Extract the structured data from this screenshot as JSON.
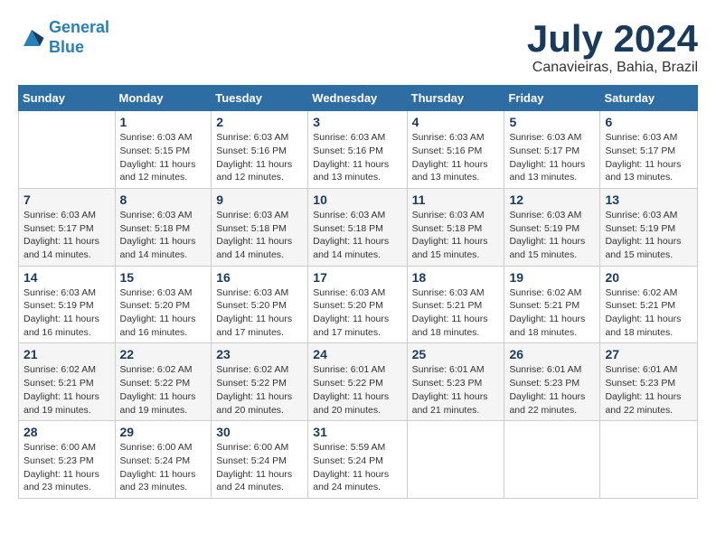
{
  "logo": {
    "line1": "General",
    "line2": "Blue"
  },
  "title": "July 2024",
  "location": "Canavieiras, Bahia, Brazil",
  "headers": [
    "Sunday",
    "Monday",
    "Tuesday",
    "Wednesday",
    "Thursday",
    "Friday",
    "Saturday"
  ],
  "weeks": [
    [
      {
        "day": "",
        "info": ""
      },
      {
        "day": "1",
        "info": "Sunrise: 6:03 AM\nSunset: 5:15 PM\nDaylight: 11 hours\nand 12 minutes."
      },
      {
        "day": "2",
        "info": "Sunrise: 6:03 AM\nSunset: 5:16 PM\nDaylight: 11 hours\nand 12 minutes."
      },
      {
        "day": "3",
        "info": "Sunrise: 6:03 AM\nSunset: 5:16 PM\nDaylight: 11 hours\nand 13 minutes."
      },
      {
        "day": "4",
        "info": "Sunrise: 6:03 AM\nSunset: 5:16 PM\nDaylight: 11 hours\nand 13 minutes."
      },
      {
        "day": "5",
        "info": "Sunrise: 6:03 AM\nSunset: 5:17 PM\nDaylight: 11 hours\nand 13 minutes."
      },
      {
        "day": "6",
        "info": "Sunrise: 6:03 AM\nSunset: 5:17 PM\nDaylight: 11 hours\nand 13 minutes."
      }
    ],
    [
      {
        "day": "7",
        "info": "Sunrise: 6:03 AM\nSunset: 5:17 PM\nDaylight: 11 hours\nand 14 minutes."
      },
      {
        "day": "8",
        "info": "Sunrise: 6:03 AM\nSunset: 5:18 PM\nDaylight: 11 hours\nand 14 minutes."
      },
      {
        "day": "9",
        "info": "Sunrise: 6:03 AM\nSunset: 5:18 PM\nDaylight: 11 hours\nand 14 minutes."
      },
      {
        "day": "10",
        "info": "Sunrise: 6:03 AM\nSunset: 5:18 PM\nDaylight: 11 hours\nand 14 minutes."
      },
      {
        "day": "11",
        "info": "Sunrise: 6:03 AM\nSunset: 5:18 PM\nDaylight: 11 hours\nand 15 minutes."
      },
      {
        "day": "12",
        "info": "Sunrise: 6:03 AM\nSunset: 5:19 PM\nDaylight: 11 hours\nand 15 minutes."
      },
      {
        "day": "13",
        "info": "Sunrise: 6:03 AM\nSunset: 5:19 PM\nDaylight: 11 hours\nand 15 minutes."
      }
    ],
    [
      {
        "day": "14",
        "info": "Sunrise: 6:03 AM\nSunset: 5:19 PM\nDaylight: 11 hours\nand 16 minutes."
      },
      {
        "day": "15",
        "info": "Sunrise: 6:03 AM\nSunset: 5:20 PM\nDaylight: 11 hours\nand 16 minutes."
      },
      {
        "day": "16",
        "info": "Sunrise: 6:03 AM\nSunset: 5:20 PM\nDaylight: 11 hours\nand 17 minutes."
      },
      {
        "day": "17",
        "info": "Sunrise: 6:03 AM\nSunset: 5:20 PM\nDaylight: 11 hours\nand 17 minutes."
      },
      {
        "day": "18",
        "info": "Sunrise: 6:03 AM\nSunset: 5:21 PM\nDaylight: 11 hours\nand 18 minutes."
      },
      {
        "day": "19",
        "info": "Sunrise: 6:02 AM\nSunset: 5:21 PM\nDaylight: 11 hours\nand 18 minutes."
      },
      {
        "day": "20",
        "info": "Sunrise: 6:02 AM\nSunset: 5:21 PM\nDaylight: 11 hours\nand 18 minutes."
      }
    ],
    [
      {
        "day": "21",
        "info": "Sunrise: 6:02 AM\nSunset: 5:21 PM\nDaylight: 11 hours\nand 19 minutes."
      },
      {
        "day": "22",
        "info": "Sunrise: 6:02 AM\nSunset: 5:22 PM\nDaylight: 11 hours\nand 19 minutes."
      },
      {
        "day": "23",
        "info": "Sunrise: 6:02 AM\nSunset: 5:22 PM\nDaylight: 11 hours\nand 20 minutes."
      },
      {
        "day": "24",
        "info": "Sunrise: 6:01 AM\nSunset: 5:22 PM\nDaylight: 11 hours\nand 20 minutes."
      },
      {
        "day": "25",
        "info": "Sunrise: 6:01 AM\nSunset: 5:23 PM\nDaylight: 11 hours\nand 21 minutes."
      },
      {
        "day": "26",
        "info": "Sunrise: 6:01 AM\nSunset: 5:23 PM\nDaylight: 11 hours\nand 22 minutes."
      },
      {
        "day": "27",
        "info": "Sunrise: 6:01 AM\nSunset: 5:23 PM\nDaylight: 11 hours\nand 22 minutes."
      }
    ],
    [
      {
        "day": "28",
        "info": "Sunrise: 6:00 AM\nSunset: 5:23 PM\nDaylight: 11 hours\nand 23 minutes."
      },
      {
        "day": "29",
        "info": "Sunrise: 6:00 AM\nSunset: 5:24 PM\nDaylight: 11 hours\nand 23 minutes."
      },
      {
        "day": "30",
        "info": "Sunrise: 6:00 AM\nSunset: 5:24 PM\nDaylight: 11 hours\nand 24 minutes."
      },
      {
        "day": "31",
        "info": "Sunrise: 5:59 AM\nSunset: 5:24 PM\nDaylight: 11 hours\nand 24 minutes."
      },
      {
        "day": "",
        "info": ""
      },
      {
        "day": "",
        "info": ""
      },
      {
        "day": "",
        "info": ""
      }
    ]
  ]
}
